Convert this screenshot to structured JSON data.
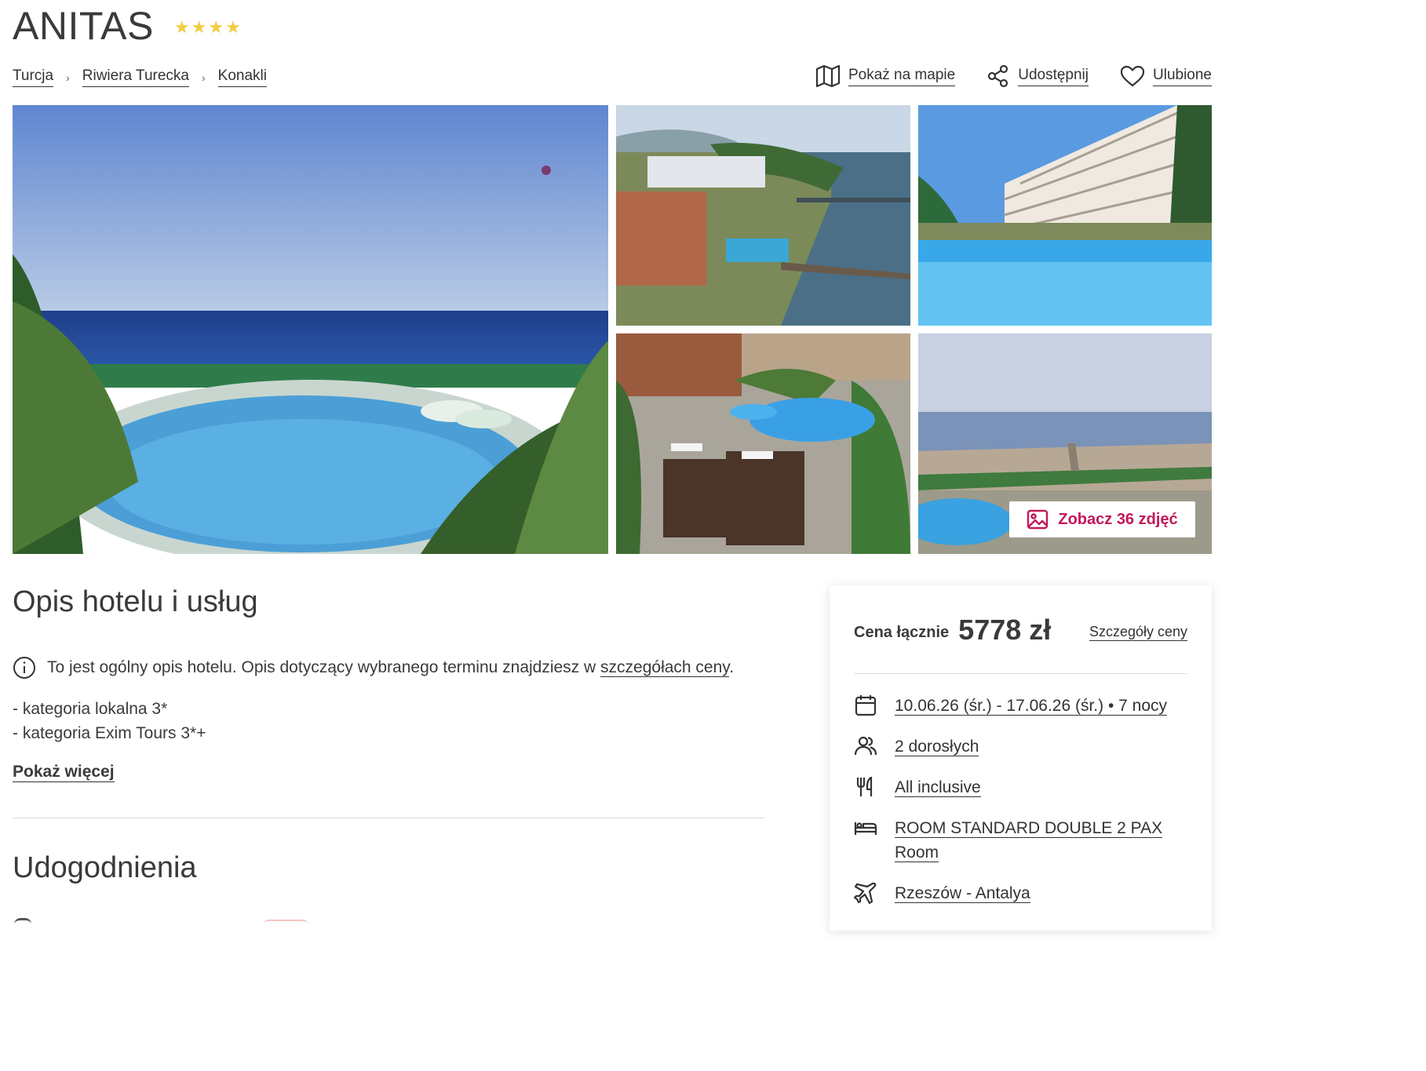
{
  "hotel": {
    "name": "ANITAS",
    "stars": 4
  },
  "breadcrumb": [
    {
      "label": "Turcja"
    },
    {
      "label": "Riwiera Turecka"
    },
    {
      "label": "Konakli"
    }
  ],
  "breadcrumb_separator": "›",
  "actions": {
    "map": "Pokaż na mapie",
    "share": "Udostępnij",
    "favorite": "Ulubione"
  },
  "gallery": {
    "see_photos": "Zobacz 36 zdjęć",
    "accent": "#c2185b"
  },
  "description": {
    "title": "Opis hotelu i usług",
    "info_prefix": "To jest ogólny opis hotelu. Opis dotyczący wybranego terminu znajdziesz w",
    "info_link": "szczegółach ceny",
    "info_suffix": ".",
    "lines": [
      "- kategoria lokalna 3*",
      "- kategoria Exim Tours 3*+"
    ],
    "show_more": "Pokaż więcej"
  },
  "amenities": {
    "title": "Udogodnienia"
  },
  "price_card": {
    "label": "Cena łącznie",
    "value": "5778 zł",
    "details_link": "Szczegóły ceny",
    "dates": "10.06.26 (śr.) - 17.06.26 (śr.) • 7 nocy",
    "people": "2 dorosłych",
    "board": "All inclusive",
    "room_line1": "ROOM STANDARD DOUBLE 2 PAX",
    "room_line2": "Room",
    "flight": "Rzeszów - Antalya"
  },
  "colors": {
    "star": "#f2cd3f",
    "text": "#3a3a3a"
  }
}
